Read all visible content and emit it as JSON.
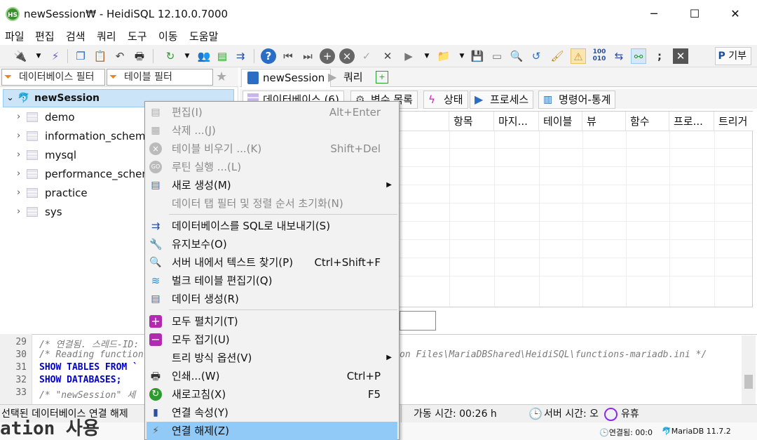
{
  "window": {
    "title": "newSession₩ - HeidiSQL 12.10.0.7000",
    "app_icon_text": "HS",
    "minimize_glyph": "─",
    "maximize_glyph": "☐",
    "close_glyph": "✕"
  },
  "menubar": [
    "파일",
    "편집",
    "검색",
    "쿼리",
    "도구",
    "이동",
    "도움말"
  ],
  "toolbar": {
    "donate_label": "기부"
  },
  "filters": {
    "database_filter": "데이터베이스 필터",
    "table_filter": "테이블 필터"
  },
  "tree": {
    "root": "newSession",
    "databases": [
      "demo",
      "information_schema",
      "mysql",
      "performance_schema",
      "practice",
      "sys"
    ]
  },
  "main_tabs": {
    "session_tab": "newSession",
    "query_tab": "쿼리"
  },
  "sub_tabs": [
    "데이터베이스 (6)",
    "변수 목록",
    "상태",
    "프로세스",
    "명령어-통계"
  ],
  "grid": {
    "columns": [
      "",
      "항목",
      "마지...",
      "테이블",
      "뷰",
      "함수",
      "프로...",
      "트리거"
    ]
  },
  "log": {
    "line_numbers": [
      "29",
      "30",
      "31",
      "32",
      "33"
    ],
    "lines": [
      "/* 연결됨. 스레드-ID: ... */",
      "/* Reading function",
      "SHOW TABLES FROM `",
      "SHOW DATABASES;",
      "/* \"newSession\" 세"
    ],
    "line30_tail": "on Files\\MariaDBShared\\HeidiSQL\\functions-mariadb.ini */"
  },
  "statusbar": {
    "selected_db": "선택된 데이터베이스 연결 해제",
    "uptime": "가동 시간: 00:26 h",
    "server_time": "서버 시간: 오",
    "idle": "유휴"
  },
  "bottomstrip": {
    "connected": "연결됨: 00:0",
    "server_version": "MariaDB 11.7.2"
  },
  "background_text": "ation 사용",
  "context_menu": {
    "items": [
      {
        "label": "편집(I)",
        "shortcut": "Alt+Enter",
        "disabled": true
      },
      {
        "label": "삭제 ...(J)",
        "shortcut": "",
        "disabled": true
      },
      {
        "label": "테이블 비우기 ...(K)",
        "shortcut": "Shift+Del",
        "disabled": true
      },
      {
        "label": "루틴 실행 ...(L)",
        "shortcut": "",
        "disabled": true
      },
      {
        "label": "새로 생성(M)",
        "shortcut": "",
        "disabled": false,
        "submenu": true
      },
      {
        "label": "데이터 탭 필터 및 정렬 순서 초기화(N)",
        "shortcut": "",
        "disabled": true
      },
      {
        "label": "데이터베이스를 SQL로 내보내기(S)",
        "shortcut": "",
        "disabled": false
      },
      {
        "label": "유지보수(O)",
        "shortcut": "",
        "disabled": false
      },
      {
        "label": "서버 내에서 텍스트 찾기(P)",
        "shortcut": "Ctrl+Shift+F",
        "disabled": false
      },
      {
        "label": "벌크 테이블 편집기(Q)",
        "shortcut": "",
        "disabled": false
      },
      {
        "label": "데이터 생성(R)",
        "shortcut": "",
        "disabled": false
      },
      {
        "label": "모두 펼치기(T)",
        "shortcut": "",
        "disabled": false
      },
      {
        "label": "모두 접기(U)",
        "shortcut": "",
        "disabled": false
      },
      {
        "label": "트리 방식 옵션(V)",
        "shortcut": "",
        "disabled": false,
        "submenu": true
      },
      {
        "label": "인쇄...(W)",
        "shortcut": "Ctrl+P",
        "disabled": false
      },
      {
        "label": "새로고침(X)",
        "shortcut": "F5",
        "disabled": false
      },
      {
        "label": "연결 속성(Y)",
        "shortcut": "",
        "disabled": false
      },
      {
        "label": "연결 해제(Z)",
        "shortcut": "",
        "disabled": false,
        "highlighted": true
      }
    ]
  },
  "colors": {
    "selection": "#cce4f7",
    "menu_highlight": "#91c9f7",
    "keyword_blue": "#0000cc",
    "comment_gray": "#7a7a7a"
  }
}
